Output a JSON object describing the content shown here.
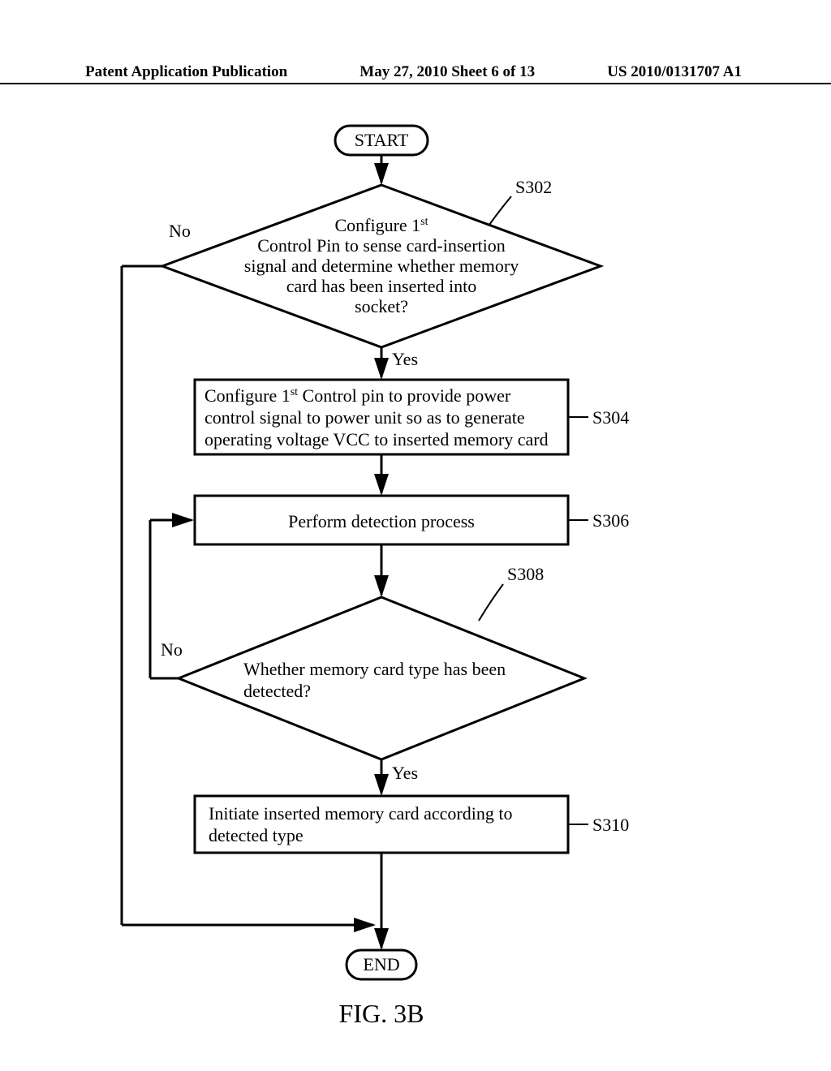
{
  "header": {
    "left": "Patent Application Publication",
    "center": "May 27, 2010  Sheet 6 of 13",
    "right": "US 2010/0131707 A1"
  },
  "flowchart": {
    "start": "START",
    "end": "END",
    "s302": {
      "ref": "S302",
      "line1_pre": "Configure 1",
      "line1_sup": "st",
      "line2": "Control Pin to sense card-insertion",
      "line3": "signal and determine whether memory",
      "line4": "card has been inserted into",
      "line5": "socket?"
    },
    "s304": {
      "ref": "S304",
      "line1_pre": "Configure 1",
      "line1_sup": "st",
      "line1_post": " Control pin to provide power",
      "line2": "control signal to power unit so as to generate",
      "line3": "operating voltage VCC to inserted memory card"
    },
    "s306": {
      "ref": "S306",
      "text": "Perform detection process"
    },
    "s308": {
      "ref": "S308",
      "line1": "Whether memory card type has been",
      "line2": "detected?"
    },
    "s310": {
      "ref": "S310",
      "line1": "Initiate inserted memory card according to",
      "line2": "detected type"
    },
    "labels": {
      "yes": "Yes",
      "no": "No"
    }
  },
  "figure_caption": "FIG.  3B"
}
